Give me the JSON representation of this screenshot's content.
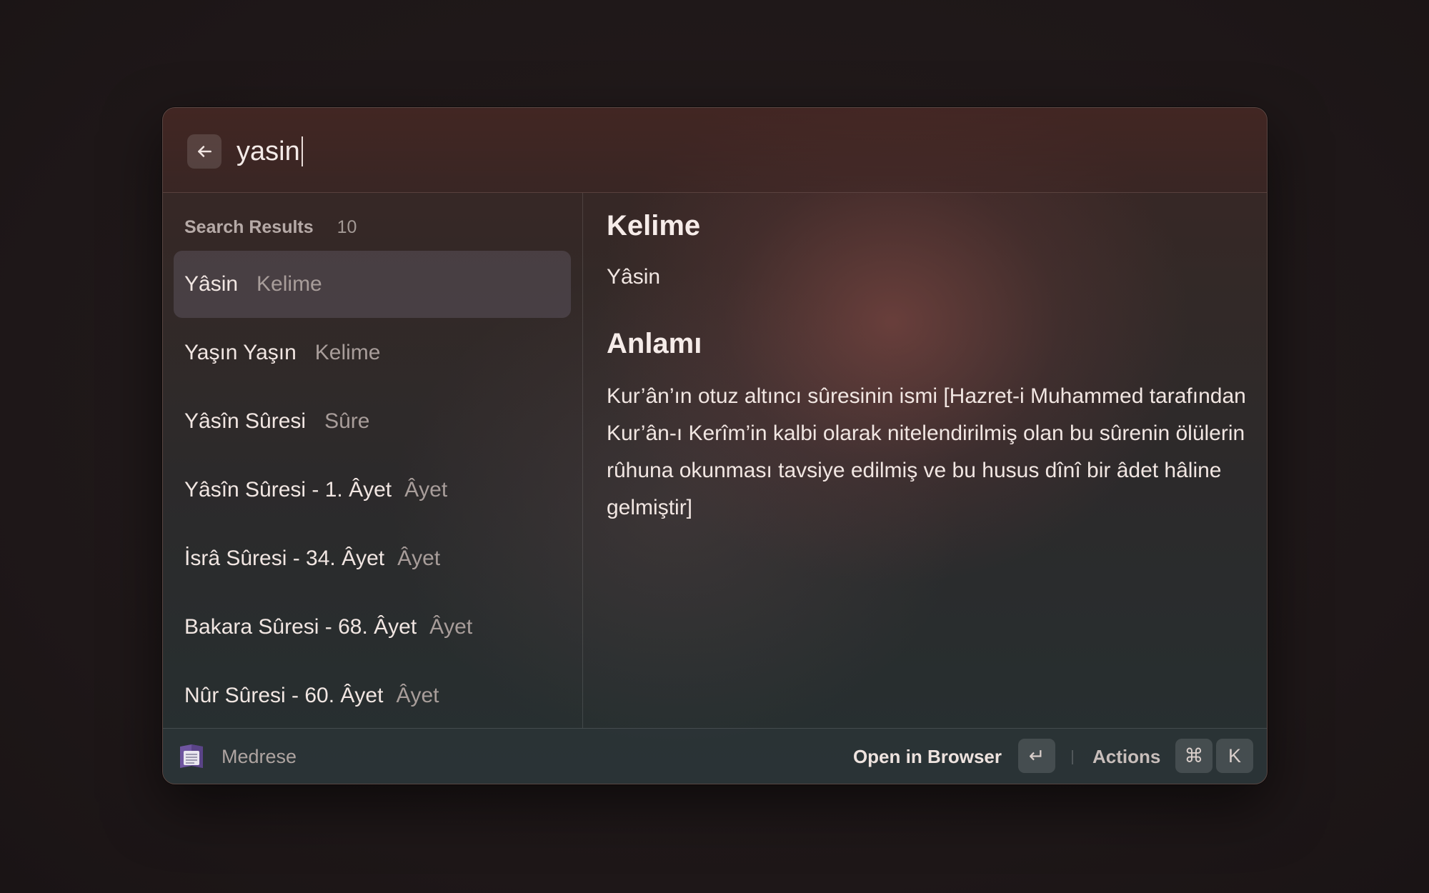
{
  "search": {
    "value": "yasin",
    "placeholder": "",
    "back_icon": "arrow-left-icon"
  },
  "results": {
    "section_title": "Search Results",
    "count": "10",
    "items": [
      {
        "title": "Yâsin",
        "accessory": "Kelime",
        "selected": true
      },
      {
        "title": "Yaşın Yaşın",
        "accessory": "Kelime",
        "selected": false
      },
      {
        "title": "Yâsîn Sûresi",
        "accessory": "Sûre",
        "selected": false
      },
      {
        "title": "Yâsîn Sûresi - 1. Âyet",
        "accessory": "Âyet",
        "selected": false
      },
      {
        "title": "İsrâ Sûresi - 34. Âyet",
        "accessory": "Âyet",
        "selected": false
      },
      {
        "title": "Bakara Sûresi - 68. Âyet",
        "accessory": "Âyet",
        "selected": false
      },
      {
        "title": "Nûr Sûresi - 60. Âyet",
        "accessory": "Âyet",
        "selected": false
      }
    ]
  },
  "detail": {
    "heading1": "Kelime",
    "text1": "Yâsin",
    "heading2": "Anlamı",
    "text2": "Kur’ân’ın otuz altıncı sûresinin ismi [Hazret-i Muhammed tarafından Kur’ân-ı Kerîm’in kalbi olarak nitelendirilmiş olan bu sûrenin ölülerin rûhuna okunması tavsiye edilmiş ve bu husus dînî bir âdet hâline gelmiştir]"
  },
  "footer": {
    "extension_name": "Medrese",
    "extension_icon": "book-icon",
    "primary_action": "Open in Browser",
    "primary_key": "↵",
    "actions_label": "Actions",
    "actions_key_1": "⌘",
    "actions_key_2": "K"
  },
  "colors": {
    "background": "#1f1819",
    "selection": "#3f3a44",
    "accent_icon": "#7b5ea7"
  }
}
